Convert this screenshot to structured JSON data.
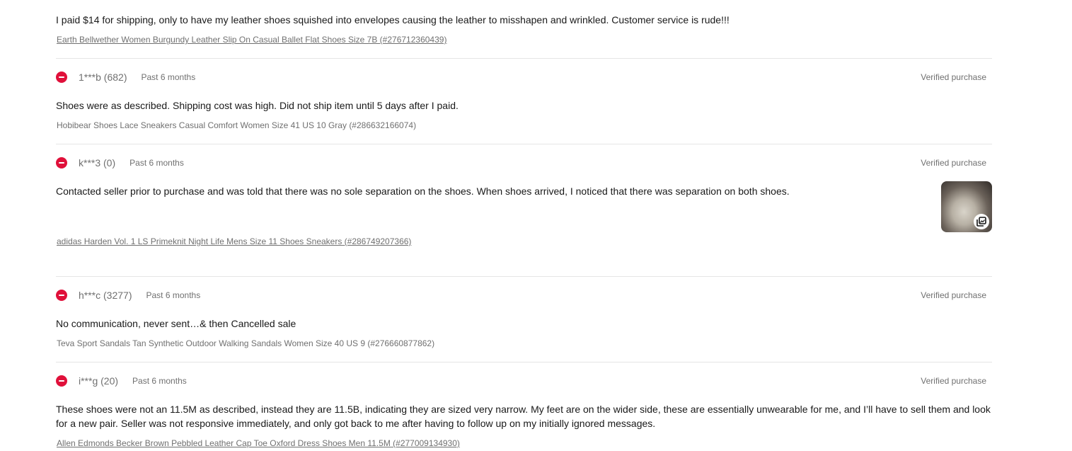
{
  "reviews": [
    {
      "text": "I paid $14 for shipping, only to have my leather shoes squished into envelopes causing the leather to misshapen and wrinkled. Customer service is rude!!!",
      "item": "Earth Bellwether Women Burgundy Leather Slip On Casual Ballet Flat Shoes Size 7B (#276712360439)"
    },
    {
      "user": "1***b (682)",
      "time": "Past 6 months",
      "verified": "Verified purchase",
      "text": "Shoes were as described. Shipping cost was high. Did not ship item until 5 days after I paid.",
      "item": "Hobibear Shoes Lace Sneakers Casual Comfort Women Size 41 US 10 Gray (#286632166074)"
    },
    {
      "user": "k***3 (0)",
      "time": "Past 6 months",
      "verified": "Verified purchase",
      "text": "Contacted seller prior to purchase and was told that there was no sole separation on the shoes. When shoes arrived, I noticed that there was separation on both shoes.",
      "item": "adidas Harden Vol. 1 LS Primeknit Night Life Mens Size 11 Shoes Sneakers (#286749207366)"
    },
    {
      "user": "h***c (3277)",
      "time": "Past 6 months",
      "verified": "Verified purchase",
      "text": "No communication, never sent…& then Cancelled sale",
      "item": "Teva Sport Sandals Tan Synthetic Outdoor Walking Sandals Women Size 40 US 9 (#276660877862)"
    },
    {
      "user": "i***g (20)",
      "time": "Past 6 months",
      "verified": "Verified purchase",
      "text": "These shoes were not an 11.5M as described, instead they are 11.5B, indicating they are sized very narrow. My feet are on the wider side, these are essentially unwearable for me, and I’ll have to sell them and look for a new pair. Seller was not responsive immediately, and only got back to me after having to follow up on my initially ignored messages.",
      "item": "Allen Edmonds Becker Brown Pebbled Leather Cap Toe Oxford Dress Shoes Men 11.5M (#277009134930)"
    }
  ],
  "colors": {
    "negative": "#e0103a",
    "muted": "#707070",
    "text": "#191919",
    "divider": "#e5e5e5"
  },
  "icons": {
    "rating": "negative-rating-icon",
    "gallery": "image-gallery-icon"
  }
}
